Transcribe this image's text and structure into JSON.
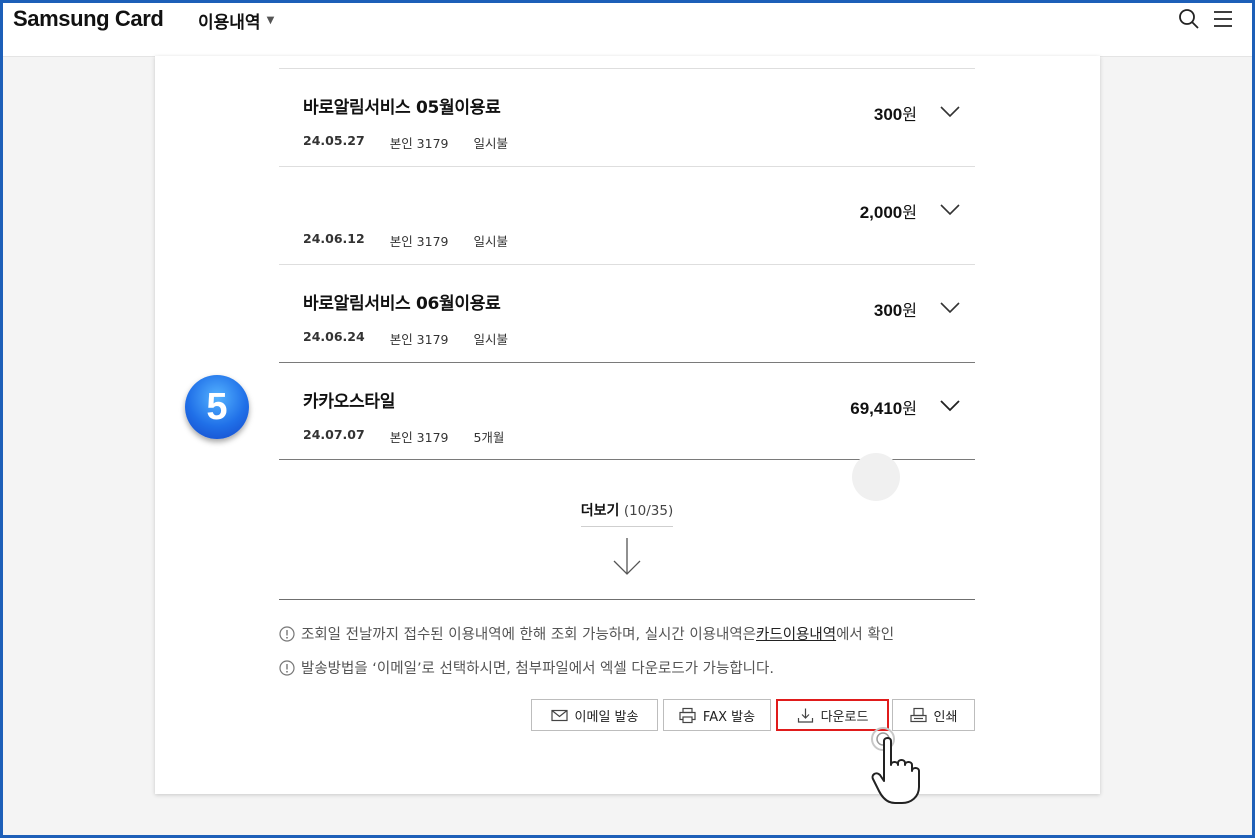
{
  "header": {
    "logo": "Samsung Card",
    "page_title": "이용내역",
    "caret": "▼"
  },
  "transactions": [
    {
      "title": "바로알림서비스 05월이용료",
      "amount": "300",
      "unit": "원",
      "date": "24.05.27",
      "card": "본인 3179",
      "plan": "일시불"
    },
    {
      "title": "",
      "amount": "2,000",
      "unit": "원",
      "date": "24.06.12",
      "card": "본인 3179",
      "plan": "일시불"
    },
    {
      "title": "바로알림서비스 06월이용료",
      "amount": "300",
      "unit": "원",
      "date": "24.06.24",
      "card": "본인 3179",
      "plan": "일시불"
    },
    {
      "title": "카카오스타일",
      "amount": "69,410",
      "unit": "원",
      "date": "24.07.07",
      "card": "본인 3179",
      "plan": "5개월"
    }
  ],
  "step_badge": "5",
  "more": {
    "label": "더보기",
    "count": "(10/35)"
  },
  "notices": {
    "n1_prefix": "조회일 전날까지 접수된 이용내역에 한해 조회 가능하며, 실시간 이용내역은 ",
    "n1_link": "카드이용내역",
    "n1_suffix": "에서 확인",
    "n2": "발송방법을 ‘이메일’로 선택하시면, 첨부파일에서 엑셀 다운로드가 가능합니다."
  },
  "buttons": {
    "email": "이메일 발송",
    "fax": "FAX 발송",
    "download": "다운로드",
    "print": "인쇄"
  },
  "colors": {
    "frame": "#1d5fb8",
    "highlight": "#e01b1b",
    "badge": "#2070e8"
  }
}
